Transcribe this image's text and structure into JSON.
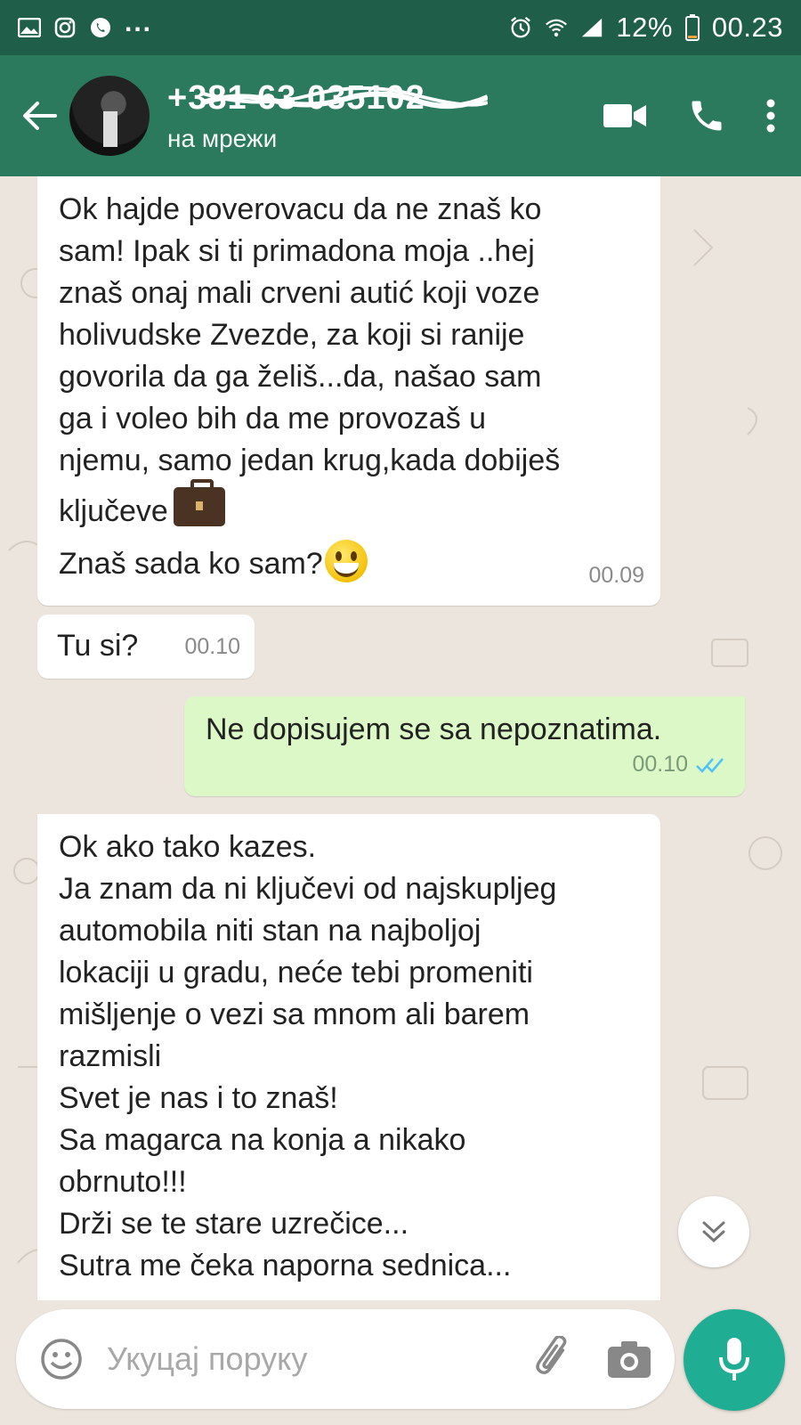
{
  "status_bar": {
    "overflow": "...",
    "battery": "12%",
    "time": "00.23"
  },
  "header": {
    "contact_name": "+381 63 035102",
    "contact_status": "на мрежи",
    "icons": [
      "back-arrow-icon",
      "video-call-icon",
      "phone-icon",
      "more-vert-icon"
    ]
  },
  "messages": [
    {
      "direction": "incoming",
      "lines": [
        "Ok hajde poverovacu da ne znaš ko",
        "sam! Ipak si ti primadona moja ..hej",
        "znaš onaj mali crveni autić koji voze",
        "holivudske Zvezde, za koji si ranije",
        "govorila da ga želiš...da, našao sam",
        "ga i voleo bih da me provozaš u",
        "njemu, samo jedan krug,kada dobiješ",
        "ključeve"
      ],
      "last_line": "Znaš sada ko sam?",
      "time": "00.09"
    },
    {
      "direction": "incoming",
      "text": "Tu si?",
      "time": "00.10"
    },
    {
      "direction": "outgoing",
      "text": "Ne dopisujem se sa nepoznatima.",
      "time": "00.10",
      "status": "read"
    },
    {
      "direction": "incoming",
      "lines": [
        "Ok ako tako kazes.",
        "Ja znam da ni ključevi od najskupljeg",
        "automobila niti stan na najboljoj",
        "lokaciji u gradu, neće tebi promeniti",
        "mišljenje o vezi sa mnom ali barem",
        "razmisli",
        "Svet je nas i to znaš!",
        "Sa magarca na konja a nikako",
        "obrnuto!!!",
        "Drži se te stare uzrečice...",
        "Sutra me čeka naporna sednica..."
      ]
    }
  ],
  "composer": {
    "placeholder": "Укуцај поруку"
  },
  "colors": {
    "status_bar": "#1f5f4a",
    "app_bar": "#2b7a5d",
    "chat_bg": "#ece5dd",
    "outgoing_bubble": "#dcf8c6",
    "mic_button": "#1fae93",
    "read_ticks": "#4fc3f7"
  }
}
